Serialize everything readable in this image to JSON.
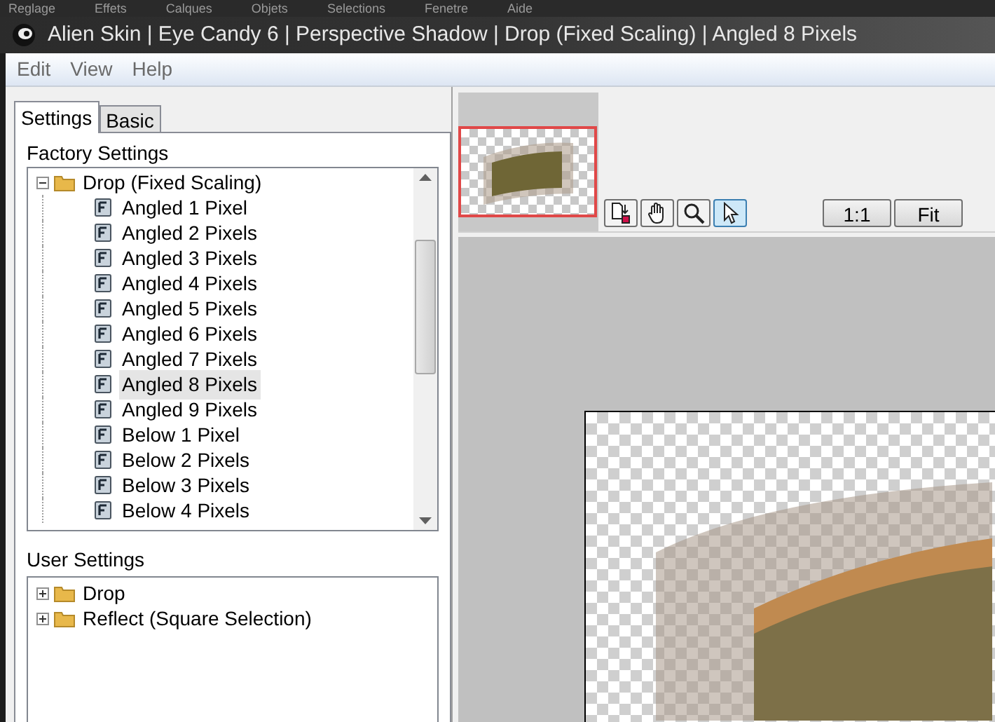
{
  "host_menu": [
    "Reglage",
    "Effets",
    "Calques",
    "Objets",
    "Selections",
    "Fenetre",
    "Aide"
  ],
  "window": {
    "title": "Alien Skin | Eye Candy 6 | Perspective Shadow | Drop (Fixed Scaling) | Angled 8 Pixels"
  },
  "menu": [
    "Edit",
    "View",
    "Help"
  ],
  "tabs": [
    {
      "label": "Settings",
      "selected": true
    },
    {
      "label": "Basic",
      "selected": false
    }
  ],
  "factory_settings": {
    "label": "Factory Settings",
    "tree": [
      {
        "label": "Drop (Fixed Scaling)",
        "expanded": true,
        "children": [
          {
            "label": "Angled 1 Pixel",
            "selected": false
          },
          {
            "label": "Angled 2 Pixels",
            "selected": false
          },
          {
            "label": "Angled 3 Pixels",
            "selected": false
          },
          {
            "label": "Angled 4 Pixels",
            "selected": false
          },
          {
            "label": "Angled 5 Pixels",
            "selected": false
          },
          {
            "label": "Angled 6 Pixels",
            "selected": false
          },
          {
            "label": "Angled 7 Pixels",
            "selected": false
          },
          {
            "label": "Angled 8 Pixels",
            "selected": true
          },
          {
            "label": "Angled 9 Pixels",
            "selected": false
          },
          {
            "label": "Below 1 Pixel",
            "selected": false
          },
          {
            "label": "Below 2 Pixels",
            "selected": false
          },
          {
            "label": "Below 3 Pixels",
            "selected": false
          },
          {
            "label": "Below 4 Pixels",
            "selected": false
          }
        ]
      }
    ]
  },
  "user_settings": {
    "label": "User Settings",
    "tree": [
      {
        "label": "Drop",
        "expanded": false
      },
      {
        "label": "Reflect (Square Selection)",
        "expanded": false
      }
    ]
  },
  "tools": [
    {
      "kind": "swap",
      "selected": false
    },
    {
      "kind": "hand",
      "selected": false
    },
    {
      "kind": "zoom",
      "selected": false
    },
    {
      "kind": "pointer",
      "selected": true
    }
  ],
  "zoom_buttons": [
    "1:1",
    "Fit"
  ]
}
